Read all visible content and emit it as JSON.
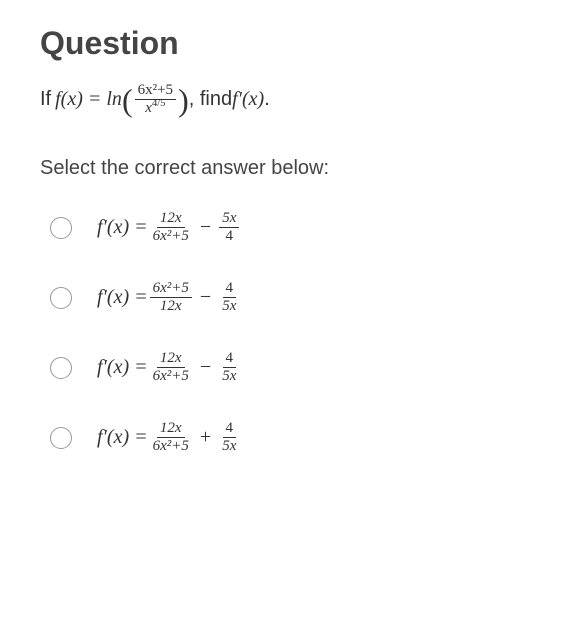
{
  "title": "Question",
  "problem": {
    "prefix": "If ",
    "func_def_lhs": "f(x) = ln",
    "frac_num": "6x²+5",
    "frac_den_base": "x",
    "frac_den_exp": "4/5",
    "suffix": ", find ",
    "find_expr": "f′(x)",
    "end": "."
  },
  "instruction": "Select the correct answer below:",
  "options": [
    {
      "lhs": "f′(x) = ",
      "term1_num": "12x",
      "term1_den": "6x²+5",
      "op": " − ",
      "term2_num": "5x",
      "term2_den": "4"
    },
    {
      "lhs": "f′(x) = ",
      "term1_num": "6x²+5",
      "term1_den": "12x",
      "op": " − ",
      "term2_num": "4",
      "term2_den": "5x"
    },
    {
      "lhs": "f′(x) = ",
      "term1_num": "12x",
      "term1_den": "6x²+5",
      "op": " − ",
      "term2_num": "4",
      "term2_den": "5x"
    },
    {
      "lhs": "f′(x) = ",
      "term1_num": "12x",
      "term1_den": "6x²+5",
      "op": " + ",
      "term2_num": "4",
      "term2_den": "5x"
    }
  ]
}
